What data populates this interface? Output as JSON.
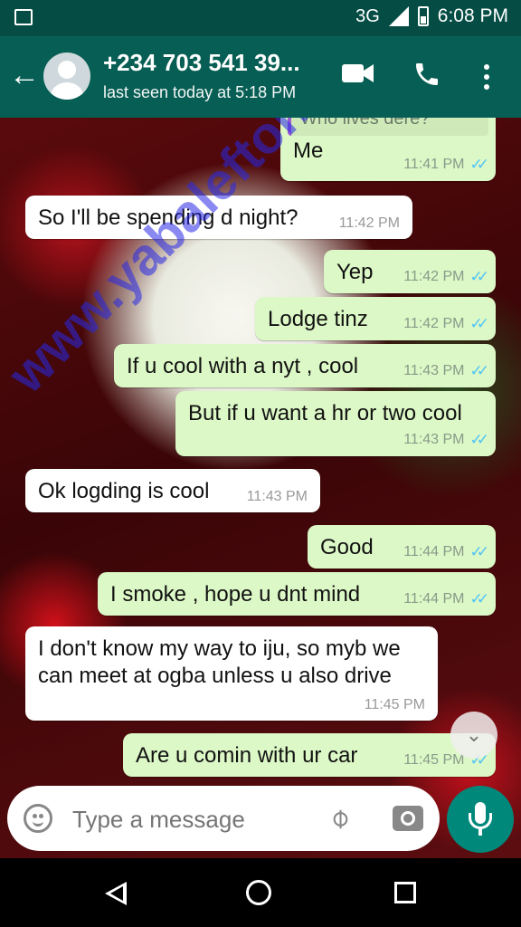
{
  "header": {
    "contact_name": "+234 703 541 39...",
    "last_seen": "last seen today at 5:18 PM"
  },
  "status_bar": {
    "network": "3G",
    "time": "6:08 PM"
  },
  "watermark": "www.yabaleftonline.ng",
  "messages": [
    {
      "dir": "out",
      "quote": "Who lives dere?",
      "text": "Me",
      "time": "11:41 PM",
      "ticks": "✓✓"
    },
    {
      "dir": "in",
      "text": "So I'll be spending d night?",
      "time": "11:42 PM"
    },
    {
      "dir": "out",
      "text": "Yep",
      "time": "11:42 PM",
      "ticks": "✓✓"
    },
    {
      "dir": "out",
      "text": "Lodge tinz",
      "time": "11:42 PM",
      "ticks": "✓✓"
    },
    {
      "dir": "out",
      "text": "If u cool with a nyt , cool",
      "time": "11:43 PM",
      "ticks": "✓✓"
    },
    {
      "dir": "out",
      "text": "But if u want a hr or two cool",
      "time": "11:43 PM",
      "ticks": "✓✓"
    },
    {
      "dir": "in",
      "text": "Ok logding is cool",
      "time": "11:43 PM"
    },
    {
      "dir": "out",
      "text": "Good",
      "time": "11:44 PM",
      "ticks": "✓✓"
    },
    {
      "dir": "out",
      "text": "I smoke , hope u dnt mind",
      "time": "11:44 PM",
      "ticks": "✓✓"
    },
    {
      "dir": "in",
      "text": "I don't know my way to iju, so myb we\ncan meet at ogba unless u also drive",
      "time": "11:45 PM"
    },
    {
      "dir": "out",
      "text": "Are u comin with ur car",
      "time": "11:45 PM",
      "ticks": "✓✓"
    }
  ],
  "composer": {
    "placeholder": "Type a message"
  },
  "icons": [
    "gallery-icon",
    "back-arrow-icon",
    "video-call-icon",
    "phone-icon",
    "more-icon",
    "emoji-icon",
    "attach-icon",
    "camera-icon",
    "mic-icon",
    "scroll-down-icon"
  ]
}
